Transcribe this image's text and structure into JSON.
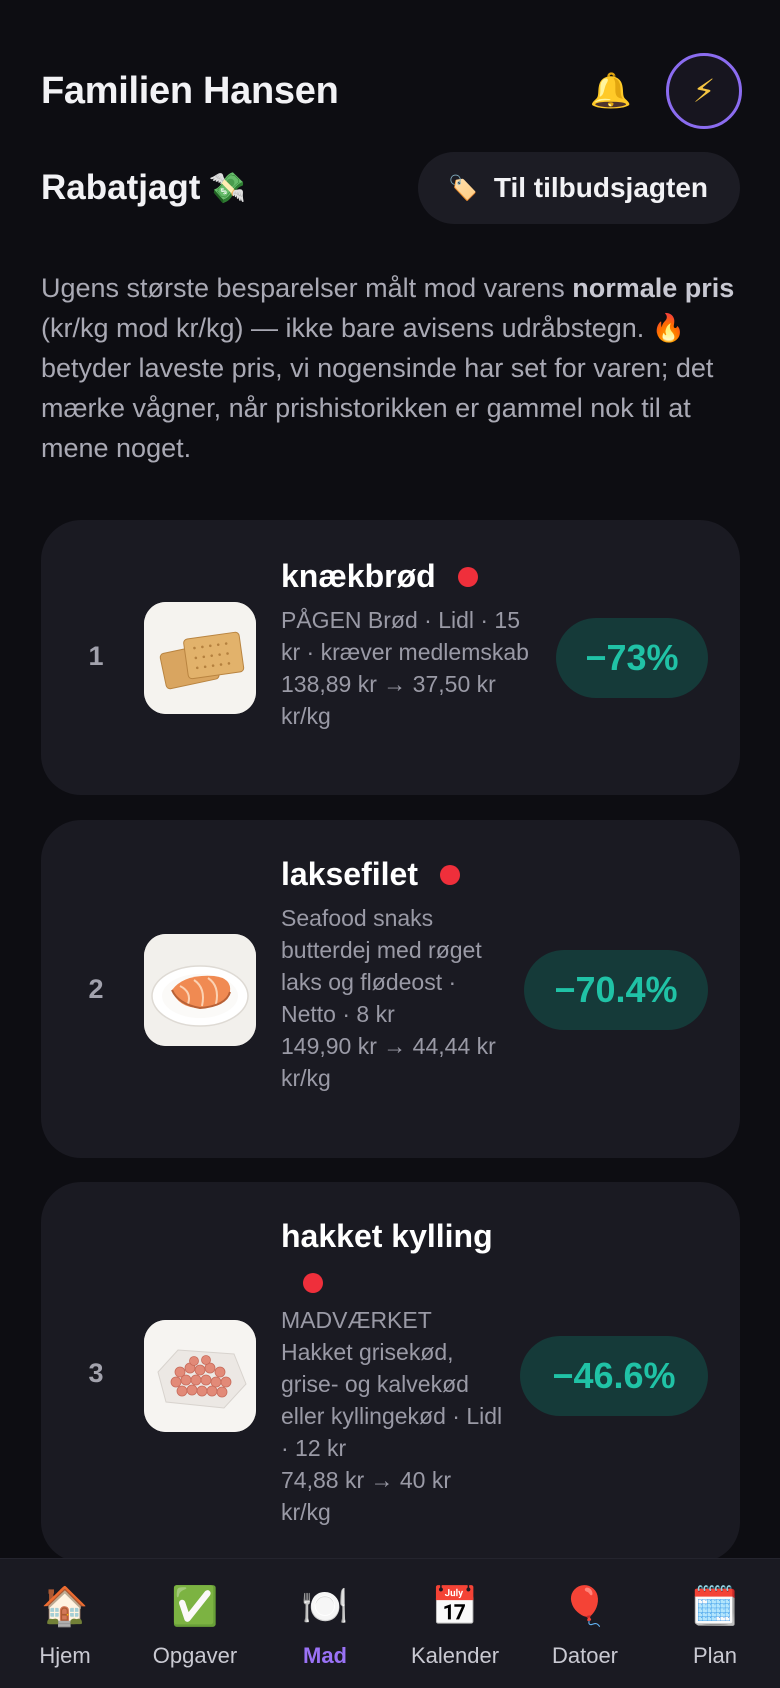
{
  "header": {
    "title": "Familien Hansen",
    "bell_icon": "🔔",
    "bolt_icon": "⚡"
  },
  "section": {
    "title": "Rabatjagt",
    "title_emoji": "💸",
    "hunt_button": {
      "icon": "🏷️",
      "label": "Til tilbudsjagten"
    }
  },
  "intro": {
    "part1": "Ugens største besparelser målt mod varens ",
    "bold": "normale pris",
    "part2": " (kr/kg mod kr/kg) — ikke bare avisens udråbstegn. ",
    "fire": "🔥",
    "part3": "  betyder laveste pris, vi nogensinde har set for varen; det mærke vågner, når prishistorikken er gammel nok til at mene noget."
  },
  "deals": [
    {
      "rank": "1",
      "name": "knækbrød",
      "details": "PÅGEN Brød · Lidl · 15 kr · kræver medlemskab",
      "price": "138,89 kr → 37,50 kr kr/kg",
      "discount": "−73%",
      "image": "crispbread"
    },
    {
      "rank": "2",
      "name": "laksefilet",
      "details": "Seafood snaks butterdej med røget laks og flødeost · Netto · 8 kr",
      "price": "149,90 kr → 44,44 kr kr/kg",
      "discount": "−70.4%",
      "image": "salmon"
    },
    {
      "rank": "3",
      "name": "hakket kylling",
      "details": "MADVÆRKET Hakket grisekød, grise- og kalvekød eller kyllingekød · Lidl · 12 kr",
      "price": "74,88 kr → 40 kr kr/kg",
      "discount": "−46.6%",
      "image": "minced-meat"
    }
  ],
  "nav": {
    "items": [
      {
        "icon": "🏠",
        "label": "Hjem"
      },
      {
        "icon": "✅",
        "label": "Opgaver"
      },
      {
        "icon": "🍽️",
        "label": "Mad"
      },
      {
        "icon": "📅",
        "label": "Kalender"
      },
      {
        "icon": "🎈",
        "label": "Datoer"
      },
      {
        "icon": "🗓️",
        "label": "Plan"
      }
    ],
    "active": "Mad"
  },
  "colors": {
    "accent": "#9a72f6",
    "discount_text": "#20c2a6",
    "discount_bg": "#153a39",
    "new_low_dot": "#ef2f3b"
  }
}
